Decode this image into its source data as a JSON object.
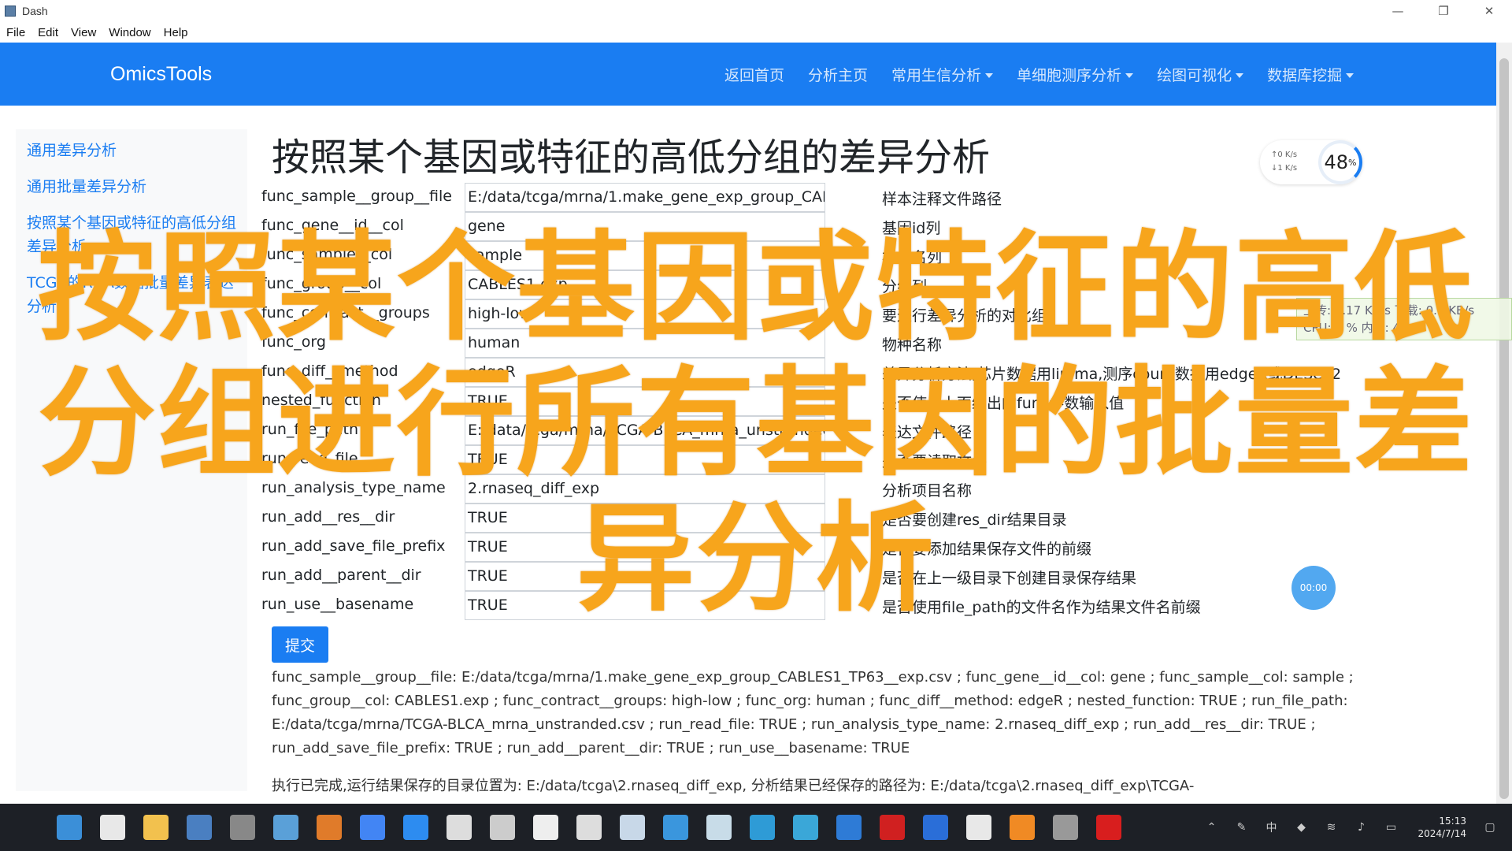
{
  "window": {
    "title": "Dash",
    "controls": [
      "—",
      "❐",
      "✕"
    ]
  },
  "menu": [
    "File",
    "Edit",
    "View",
    "Window",
    "Help"
  ],
  "navbar": {
    "brand": "OmicsTools",
    "items": [
      {
        "label": "返回首页",
        "dropdown": false
      },
      {
        "label": "分析主页",
        "dropdown": false
      },
      {
        "label": "常用生信分析",
        "dropdown": true
      },
      {
        "label": "单细胞测序分析",
        "dropdown": true
      },
      {
        "label": "绘图可视化",
        "dropdown": true
      },
      {
        "label": "数据库挖掘",
        "dropdown": true
      }
    ]
  },
  "sidebar": {
    "items": [
      "通用差异分析",
      "通用批量差异分析",
      "按照某个基因或特征的高低分组差异分析",
      "TCGA的RNA数据批量差异表达分析"
    ]
  },
  "main": {
    "title": "按照某个基因或特征的高低分组的差异分析",
    "rows": [
      {
        "label": "func_sample__group__file",
        "value": "E:/data/tcga/mrna/1.make_gene_exp_group_CABLES1_TP63__exp.csv",
        "desc": "样本注释文件路径"
      },
      {
        "label": "func_gene__id__col",
        "value": "gene",
        "desc": "基因id列"
      },
      {
        "label": "func_sample__col",
        "value": "sample",
        "desc": "样本名列"
      },
      {
        "label": "func_group__col",
        "value": "CABLES1.exp",
        "desc": "分组列"
      },
      {
        "label": "func_contract__groups",
        "value": "high-low",
        "desc": "要进行差异分析的对比组"
      },
      {
        "label": "func_org",
        "value": "human",
        "desc": "物种名称"
      },
      {
        "label": "func_diff__method",
        "value": "edgeR",
        "desc": "差异分析方法,芯片数据用limma,测序count数据用edgeR或DESeq2"
      },
      {
        "label": "nested_function",
        "value": "TRUE",
        "desc": "是否使用上面给出的func参数输入值"
      },
      {
        "label": "run_file_path",
        "value": "E:/data/tcga/mrna/TCGA-BLCA_mrna_unstranded.csv",
        "desc": "表达文件路径"
      },
      {
        "label": "run_read_file",
        "value": "TRUE",
        "desc": "是否要读取文件"
      },
      {
        "label": "run_analysis_type_name",
        "value": "2.rnaseq_diff_exp",
        "desc": "分析项目名称"
      },
      {
        "label": "run_add__res__dir",
        "value": "TRUE",
        "desc": "是否要创建res_dir结果目录"
      },
      {
        "label": "run_add_save_file_prefix",
        "value": "TRUE",
        "desc": "是否要添加结果保存文件的前缀"
      },
      {
        "label": "run_add__parent__dir",
        "value": "TRUE",
        "desc": "是否在上一级目录下创建目录保存结果"
      },
      {
        "label": "run_use__basename",
        "value": "TRUE",
        "desc": "是否使用file_path的文件名作为结果文件名前缀"
      }
    ],
    "submit_label": "提交",
    "output_text": "func_sample__group__file: E:/data/tcga/mrna/1.make_gene_exp_group_CABLES1_TP63__exp.csv ; func_gene__id__col: gene ; func_sample__col: sample ; func_group__col: CABLES1.exp ; func_contract__groups: high-low ; func_org: human ; func_diff__method: edgeR ; nested_function: TRUE ; run_file_path: E:/data/tcga/mrna/TCGA-BLCA_mrna_unstranded.csv ; run_read_file: TRUE ; run_analysis_type_name: 2.rnaseq_diff_exp ; run_add__res__dir: TRUE ; run_add_save_file_prefix: TRUE ; run_add__parent__dir: TRUE ; run_use__basename: TRUE",
    "result_text": "执行已完成,运行结果保存的目录位置为: E:/data/tcga\\2.rnaseq_diff_exp, 分析结果已经保存的路径为: E:/data/tcga\\2.rnaseq_diff_exp\\TCGA-"
  },
  "widgets": {
    "up_speed": "↑0 K/s",
    "down_speed": "↓1 K/s",
    "percent": "48",
    "percent_unit": "%",
    "status_line1": "上传: 0.17 KB/s 下载: 0.5 KB/s",
    "status_line2": "CPU: 7 % 内存: 47 %",
    "float_btn": "00:00"
  },
  "overlay": {
    "caption": "按照某个基因或特征的高低分组进行所有基因的批量差异分析",
    "color": "#f7a51c"
  },
  "taskbar": {
    "icons": [
      {
        "name": "start-icon",
        "color": "#3b8fd8"
      },
      {
        "name": "desktop-icon",
        "color": "#e8e8e8"
      },
      {
        "name": "file-explorer-icon",
        "color": "#f2c14e"
      },
      {
        "name": "monitor-icon",
        "color": "#4a7fc1"
      },
      {
        "name": "terminal-icon",
        "color": "#888888"
      },
      {
        "name": "photos-icon",
        "color": "#5aa0d8"
      },
      {
        "name": "matlab-icon",
        "color": "#e07b2a"
      },
      {
        "name": "chrome-icon",
        "color": "#4285f4"
      },
      {
        "name": "meeting-icon",
        "color": "#2d8cf0"
      },
      {
        "name": "mail-icon",
        "color": "#dddddd"
      },
      {
        "name": "github-icon",
        "color": "#cccccc"
      },
      {
        "name": "typora-icon",
        "color": "#eeeeee"
      },
      {
        "name": "settings-icon",
        "color": "#dddddd"
      },
      {
        "name": "notes-icon",
        "color": "#c8d8e8"
      },
      {
        "name": "vscode-icon",
        "color": "#3a96dd"
      },
      {
        "name": "folder-icon",
        "color": "#c8dce8"
      },
      {
        "name": "edge-icon",
        "color": "#2e9bd6"
      },
      {
        "name": "store-icon",
        "color": "#3aa7d8"
      },
      {
        "name": "vs-icon",
        "color": "#2e7bd6"
      },
      {
        "name": "app-red-icon",
        "color": "#d02020"
      },
      {
        "name": "app-blue-icon",
        "color": "#2a6ed8"
      },
      {
        "name": "screenshot-icon",
        "color": "#e8e8e8"
      },
      {
        "name": "vlc-icon",
        "color": "#f08a24"
      },
      {
        "name": "app-b-icon",
        "color": "#999999"
      },
      {
        "name": "heart-icon",
        "color": "#d81e1e"
      }
    ],
    "time": "15:13",
    "date": "2024/7/14"
  }
}
